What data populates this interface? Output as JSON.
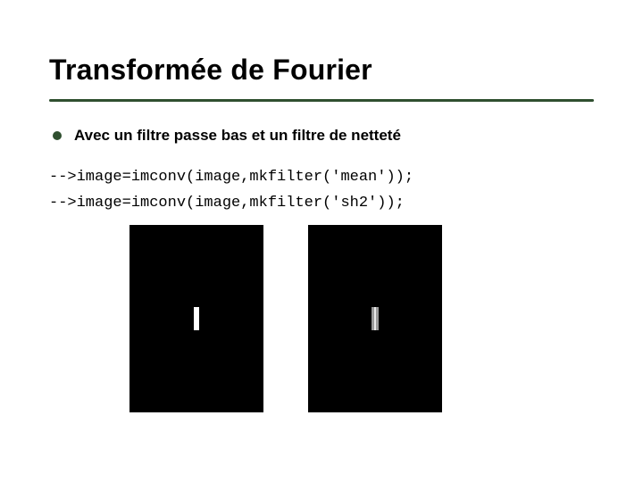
{
  "title": "Transformée de Fourier",
  "bullet": "Avec un filtre passe bas et un filtre de netteté",
  "code_line_1": "-->image=imconv(image,mkfilter('mean'));",
  "code_line_2": "-->image=imconv(image,mkfilter('sh2'));"
}
